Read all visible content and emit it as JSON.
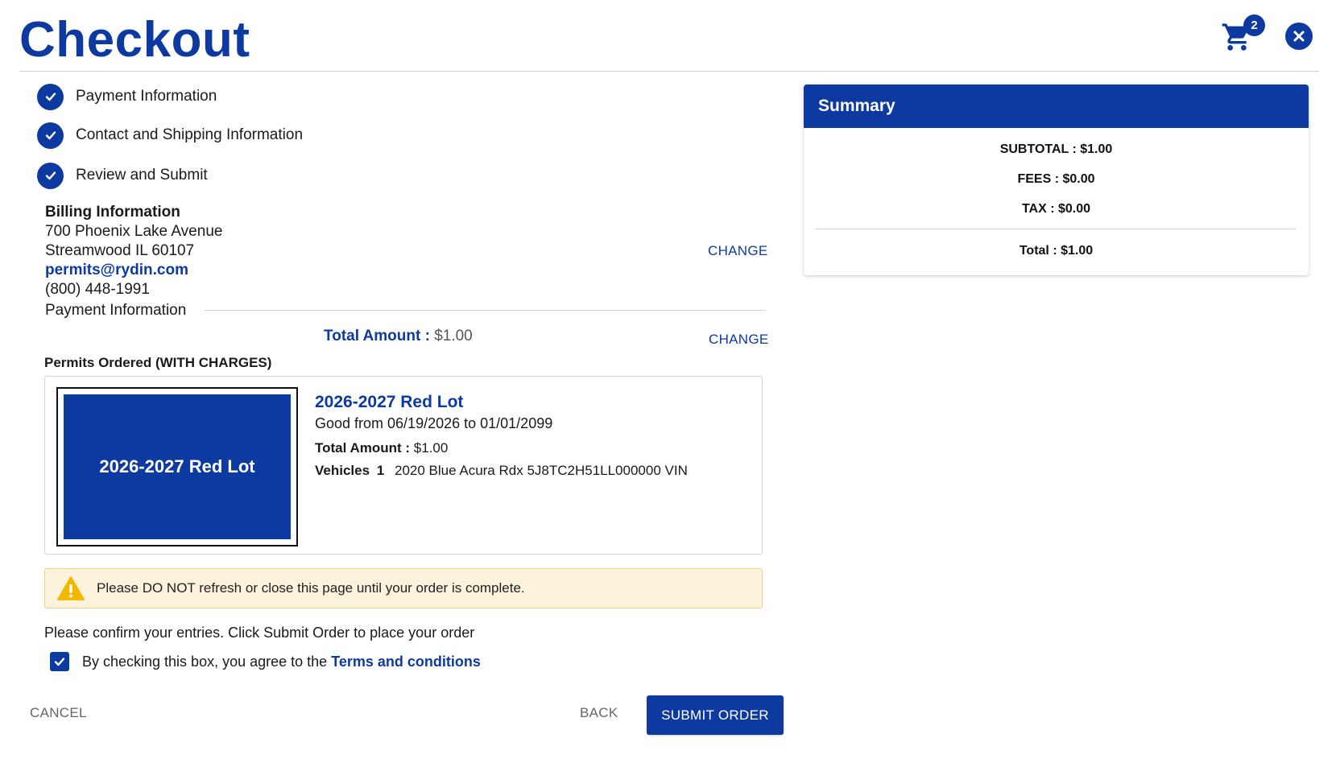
{
  "header": {
    "title": "Checkout",
    "cart_count": "2"
  },
  "steps": [
    {
      "label": "Payment Information"
    },
    {
      "label": "Contact and Shipping Information"
    },
    {
      "label": "Review and Submit"
    }
  ],
  "billing": {
    "heading": "Billing Information",
    "address_line1": "700 Phoenix Lake Avenue",
    "address_line2": "Streamwood IL 60107",
    "email": "permits@rydin.com",
    "phone": "(800) 448-1991",
    "change_label": "CHANGE"
  },
  "payment": {
    "heading": "Payment Information",
    "total_label": "Total Amount :",
    "total_value": "$1.00",
    "change_label": "CHANGE"
  },
  "permits": {
    "heading": "Permits Ordered (WITH CHARGES)",
    "items": [
      {
        "image_label": "2026-2027 Red Lot",
        "title": "2026-2027 Red Lot",
        "valid": "Good from 06/19/2026 to 01/01/2099",
        "total_label": "Total Amount :",
        "total_value": "$1.00",
        "vehicles_label": "Vehicles",
        "vehicles_count": "1",
        "vehicle_desc": "2020 Blue Acura Rdx 5J8TC2H51LL000000 VIN"
      }
    ]
  },
  "warning": {
    "text": "Please DO NOT refresh or close this page until your order is complete."
  },
  "confirm": {
    "text": "Please confirm your entries. Click Submit Order to place your order",
    "agree_text": "By checking this box, you agree to the",
    "terms_label": "Terms and conditions",
    "checked": true
  },
  "actions": {
    "cancel_label": "CANCEL",
    "back_label": "BACK",
    "submit_label": "SUBMIT ORDER"
  },
  "summary": {
    "title": "Summary",
    "subtotal": "SUBTOTAL : $1.00",
    "fees": "FEES : $0.00",
    "tax": "TAX : $0.00",
    "total": "Total : $1.00"
  },
  "colors": {
    "primary": "#0d3aa1",
    "warning_bg": "#fdf3dc",
    "warning_icon": "#f5b800"
  }
}
